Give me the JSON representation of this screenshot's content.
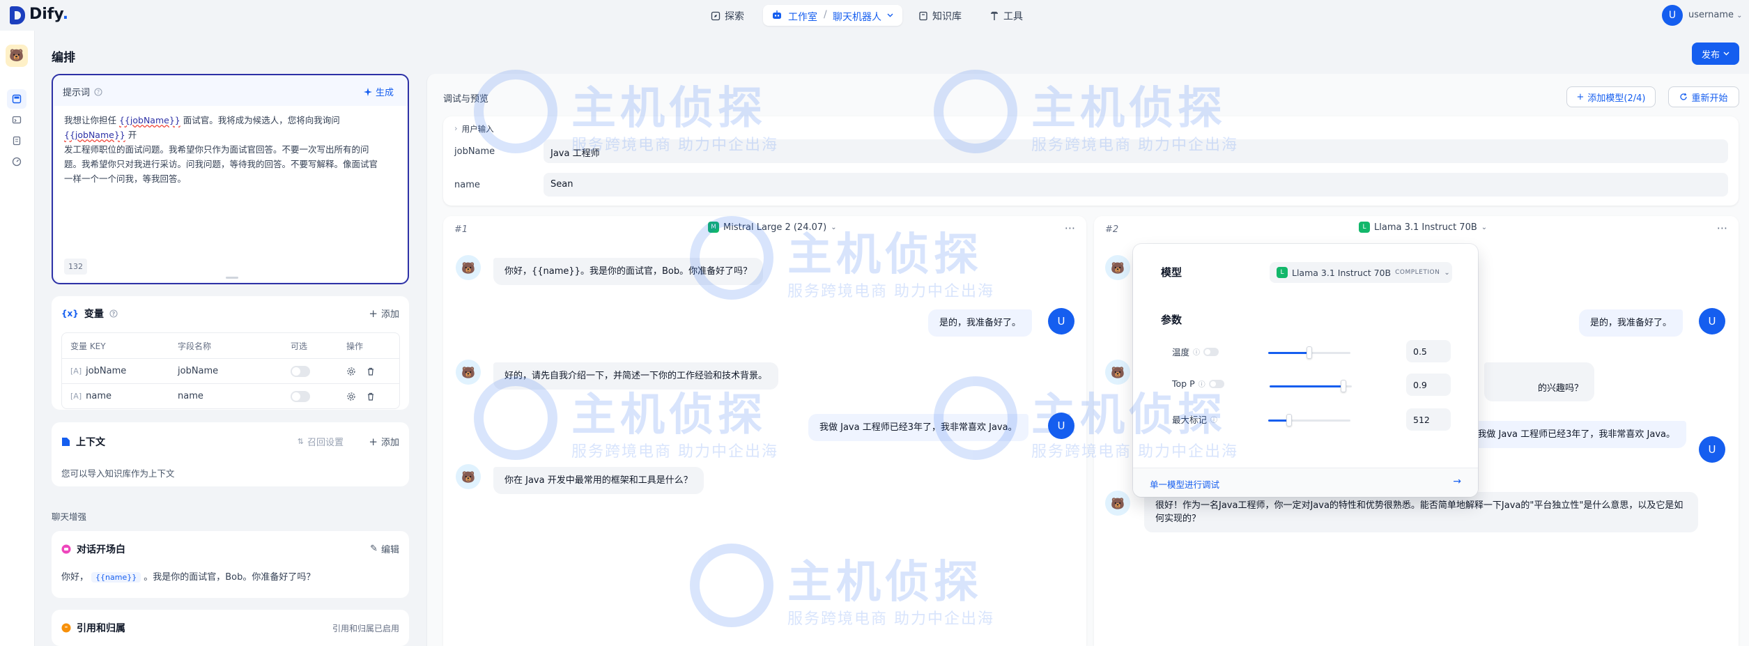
{
  "app": {
    "logo": "Dify",
    "logo_dot": "."
  },
  "nav": {
    "explore": "探索",
    "studio": "工作室",
    "current_app": "聊天机器人",
    "knowledge": "知识库",
    "tools": "工具"
  },
  "user": {
    "initial": "U",
    "name": "username"
  },
  "main": {
    "title": "编排",
    "publish": "发布"
  },
  "prompt": {
    "title": "提示词",
    "generate": "生成",
    "lines": [
      [
        "我想让你担任 ",
        "{{jobName}}",
        " 面试官。我将成为候选人，您将向我询问 ",
        "{{jobName}}",
        " 开"
      ],
      [
        "发工程师职位的面试问题。我希望你只作为面试官回答。不要一次写出所有的问"
      ],
      [
        "题。我希望你只对我进行采访。问我问题，等待我的回答。不要写解释。像面试官"
      ],
      [
        "一样一个一个问我，等我回答。"
      ]
    ],
    "count": "132"
  },
  "variables": {
    "title": "变量",
    "add": "添加",
    "headers": [
      "变量 KEY",
      "字段名称",
      "可选",
      "操作"
    ],
    "rows": [
      {
        "key": "jobName",
        "name": "jobName"
      },
      {
        "key": "name",
        "name": "name"
      }
    ]
  },
  "context": {
    "title": "上下文",
    "retrieval": "召回设置",
    "add": "添加",
    "empty": "您可以导入知识库作为上下文"
  },
  "enhance": {
    "label": "聊天增强"
  },
  "opener": {
    "title": "对话开场白",
    "edit": "编辑",
    "prefix": "你好，",
    "chip": "{{name}}",
    "suffix": "。我是你的面试官，Bob。你准备好了吗？"
  },
  "citation": {
    "title": "引用和归属",
    "status": "引用和归属已启用"
  },
  "debug": {
    "title": "调试与预览",
    "add_model": "添加模型(2/4)",
    "restart": "重新开始",
    "user_input": "用户输入",
    "inputs": [
      {
        "label": "jobName",
        "value": "Java 工程师"
      },
      {
        "label": "name",
        "value": "Sean"
      }
    ]
  },
  "col1": {
    "num": "#1",
    "model": "Mistral Large 2 (24.07)",
    "messages": [
      {
        "role": "bot",
        "text": "你好，{{name}}。我是你的面试官，Bob。你准备好了吗？"
      },
      {
        "role": "user",
        "text": "是的，我准备好了。"
      },
      {
        "role": "bot",
        "text": "好的，请先自我介绍一下，并简述一下你的工作经验和技术背景。"
      },
      {
        "role": "user",
        "text": "我做 Java 工程师已经3年了，我非常喜欢 Java。"
      },
      {
        "role": "bot",
        "text": "你在 Java 开发中最常用的框架和工具是什么？"
      }
    ]
  },
  "col2": {
    "num": "#2",
    "model": "Llama 3.1 Instruct 70B",
    "messages": [
      {
        "role": "user",
        "text": "是的，我准备好了。"
      },
      {
        "role": "bot_partial",
        "text": "的兴趣吗？"
      },
      {
        "role": "user_partial",
        "text": "我做 Java 工程师已经3年了，我非常喜欢 Java。"
      },
      {
        "role": "bot",
        "text": "很好！作为一名Java工程师，你一定对Java的特性和优势很熟悉。能否简单地解释一下Java的\"平台独立性\"是什么意思，以及它是如何实现的？"
      }
    ]
  },
  "popover": {
    "model_title": "模型",
    "model_name": "Llama 3.1 Instruct 70B",
    "model_mode": "COMPLETION",
    "params_title": "参数",
    "params": [
      {
        "label": "温度",
        "value": "0.5",
        "level": 0.5
      },
      {
        "label": "Top P",
        "value": "0.9",
        "level": 0.9
      },
      {
        "label": "最大标记",
        "value": "512",
        "level": 0.25
      }
    ],
    "footer": "单一模型进行调试"
  },
  "watermark": {
    "brand": "主机侦探",
    "slogan": "服务跨境电商 助力中企出海"
  },
  "icons": [
    "compass-icon",
    "robot-icon",
    "book-icon",
    "tool-icon",
    "sparkle-icon",
    "braces-icon",
    "doc-icon",
    "chat-icon",
    "gear-icon",
    "trash-icon",
    "plus-icon",
    "refresh-icon",
    "chevron-down-icon",
    "more-icon",
    "arrow-right-icon",
    "help-icon"
  ],
  "colors": {
    "primary": "#155eef",
    "prompt_border": "#2d31a6",
    "model_badge": "#12b76a"
  }
}
